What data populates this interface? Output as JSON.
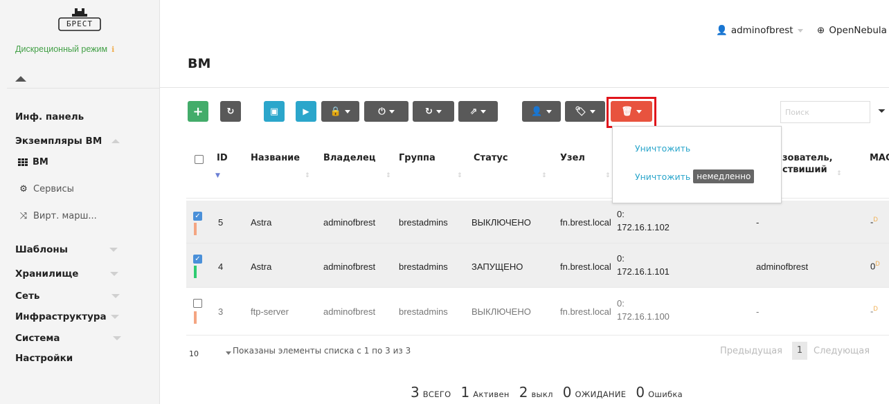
{
  "sidebar": {
    "logo_text": "БРЕСТ",
    "mode_label": "Дискреционный режим",
    "mode_info_icon": "info-icon",
    "nav": {
      "dashboard": "Инф. панель",
      "vm_instances": "Экземпляры ВМ",
      "vms": "ВМ",
      "services": "Сервисы",
      "vrouters": "Вирт. марш...",
      "templates": "Шаблоны",
      "storage": "Хранилище",
      "network": "Сеть",
      "infrastructure": "Инфраструктура",
      "system": "Система",
      "settings": "Настройки"
    }
  },
  "header": {
    "user": "adminofbrest",
    "zone": "OpenNebula",
    "title": "ВМ"
  },
  "toolbar": {
    "search_placeholder": "Поиск",
    "delete_menu": {
      "terminate": "Уничтожить",
      "terminate_hard": "Уничтожить",
      "terminate_hard_badge": "немедленно"
    },
    "colors": {
      "green": "#43ac6a",
      "blue": "#2ba6cb",
      "gray": "#595959",
      "red": "#e8533e",
      "highlight": "#e0141b"
    }
  },
  "table": {
    "headers": {
      "id": "ID",
      "name": "Название",
      "owner": "Владелец",
      "group": "Группа",
      "status": "Статус",
      "host": "Узел",
      "last_user_a": "зователь,",
      "last_user_b": "ствиший",
      "mac": "MAC"
    },
    "rows": [
      {
        "checked": true,
        "state_color": "#f4a582",
        "id": "5",
        "name": "Astra",
        "owner": "adminofbrest",
        "group": "brestadmins",
        "status": "ВЫКЛЮЧЕНО",
        "host": "fn.brest.local",
        "ip_a": "0:",
        "ip_b": "172.16.1.102",
        "last_user": "-",
        "mac": "-",
        "mac_flag": "D"
      },
      {
        "checked": true,
        "state_color": "#2ecc71",
        "id": "4",
        "name": "Astra",
        "owner": "adminofbrest",
        "group": "brestadmins",
        "status": "ЗАПУЩЕНО",
        "host": "fn.brest.local",
        "ip_a": "0:",
        "ip_b": "172.16.1.101",
        "last_user": "adminofbrest",
        "mac": "0",
        "mac_flag": "D"
      },
      {
        "checked": false,
        "state_color": "#f4a582",
        "id": "3",
        "name": "ftp-server",
        "owner": "adminofbrest",
        "group": "brestadmins",
        "status": "ВЫКЛЮЧЕНО",
        "host": "fn.brest.local",
        "ip_a": "0:",
        "ip_b": "172.16.1.100",
        "last_user": "-",
        "mac": "-",
        "mac_flag": "D"
      }
    ]
  },
  "footer": {
    "page_length": "10",
    "info": "Показаны элементы списка с 1 по 3 из 3",
    "prev": "Предыдущая",
    "current_page": "1",
    "next": "Следующая"
  },
  "stats": [
    {
      "n": "3",
      "label": "ВСЕГО",
      "color": "#333333"
    },
    {
      "n": "1",
      "label": "Активен",
      "color": "#333333"
    },
    {
      "n": "2",
      "label": "выкл",
      "color": "#333333"
    },
    {
      "n": "0",
      "label": "ОЖИДАНИЕ",
      "color": "#333333"
    },
    {
      "n": "0",
      "label": "Ошибка",
      "color": "#333333"
    }
  ]
}
